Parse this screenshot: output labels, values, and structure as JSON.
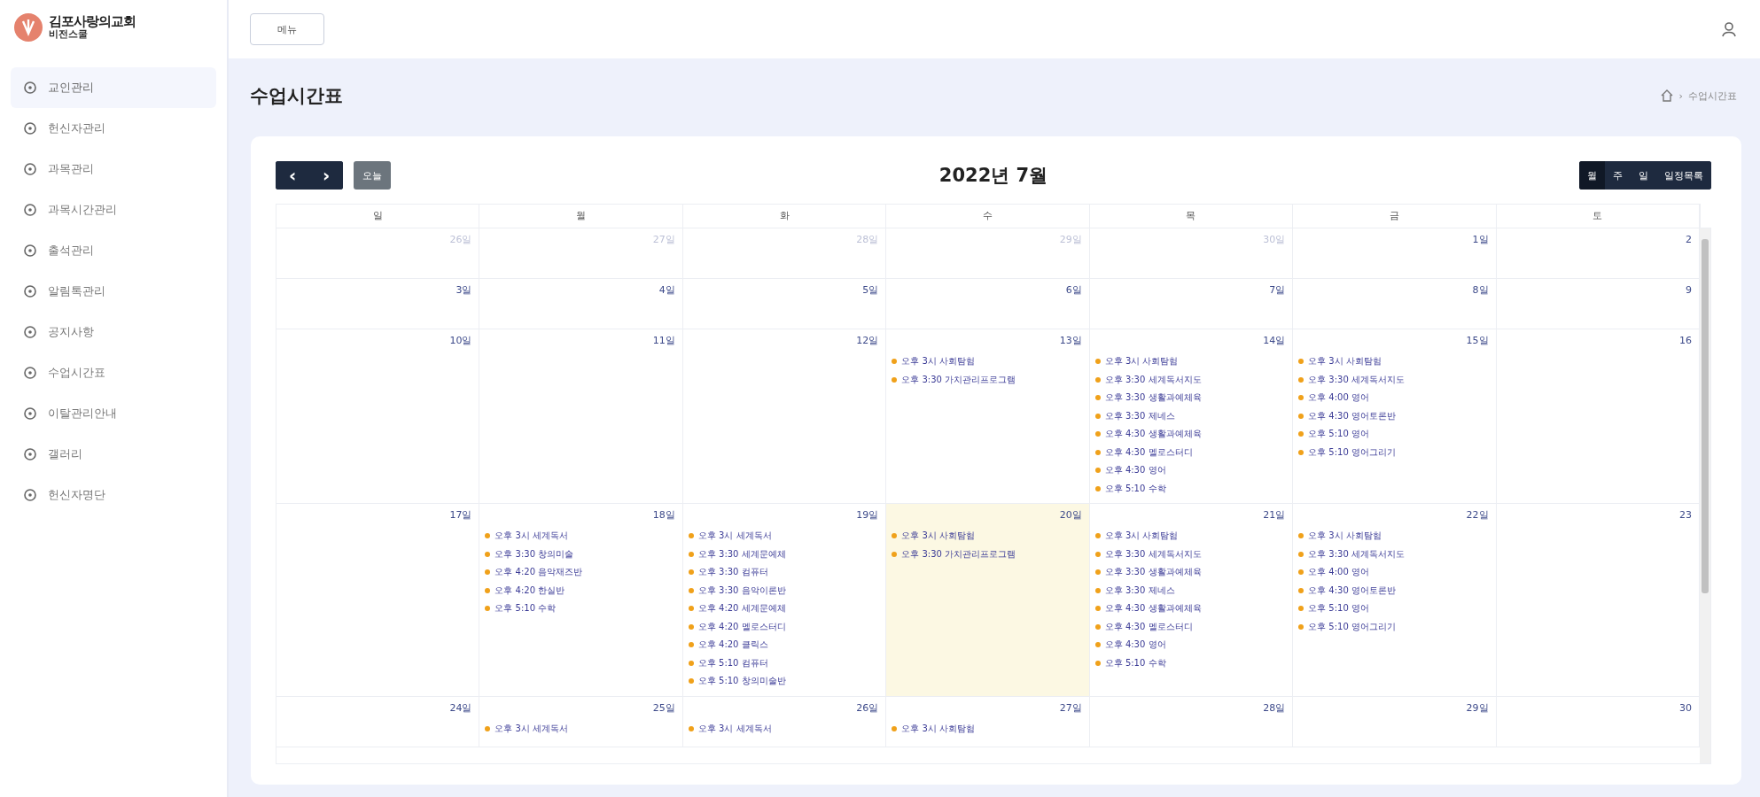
{
  "brand": {
    "name": "김포사랑의교회",
    "subtitle": "비전스쿨"
  },
  "sidebar": {
    "items": [
      {
        "label": "교인관리",
        "selected": true
      },
      {
        "label": "헌신자관리",
        "selected": false
      },
      {
        "label": "과목관리",
        "selected": false
      },
      {
        "label": "과목시간관리",
        "selected": false
      },
      {
        "label": "출석관리",
        "selected": false
      },
      {
        "label": "알림톡관리",
        "selected": false
      },
      {
        "label": "공지사항",
        "selected": false
      },
      {
        "label": "수업시간표",
        "selected": false
      },
      {
        "label": "이탈관리안내",
        "selected": false
      },
      {
        "label": "갤러리",
        "selected": false
      },
      {
        "label": "헌신자명단",
        "selected": false
      }
    ]
  },
  "topbar": {
    "menu_button": "메뉴"
  },
  "page": {
    "title": "수업시간표",
    "breadcrumb": [
      {
        "label": "›"
      },
      {
        "label": "수업시간표"
      }
    ]
  },
  "calendar": {
    "title": "2022년 7월",
    "prev": "‹",
    "next": "›",
    "today_button": "오늘",
    "views": [
      {
        "label": "월",
        "selected": true
      },
      {
        "label": "주",
        "selected": false
      },
      {
        "label": "일",
        "selected": false
      },
      {
        "label": "일정목록",
        "selected": false
      }
    ],
    "weekdays": [
      "일",
      "월",
      "화",
      "수",
      "목",
      "금",
      "토"
    ],
    "weeks": [
      {
        "days": [
          {
            "label": "26일",
            "other_month": true,
            "today": false
          },
          {
            "label": "27일",
            "other_month": true,
            "today": false
          },
          {
            "label": "28일",
            "other_month": true,
            "today": false
          },
          {
            "label": "29일",
            "other_month": true,
            "today": false
          },
          {
            "label": "30일",
            "other_month": true,
            "today": false
          },
          {
            "label": "1일",
            "other_month": false,
            "today": false
          },
          {
            "label": "2",
            "other_month": false,
            "today": false
          }
        ]
      },
      {
        "days": [
          {
            "label": "3일",
            "other_month": false,
            "today": false
          },
          {
            "label": "4일",
            "other_month": false,
            "today": false
          },
          {
            "label": "5일",
            "other_month": false,
            "today": false
          },
          {
            "label": "6일",
            "other_month": false,
            "today": false
          },
          {
            "label": "7일",
            "other_month": false,
            "today": false
          },
          {
            "label": "8일",
            "other_month": false,
            "today": false
          },
          {
            "label": "9",
            "other_month": false,
            "today": false
          }
        ]
      },
      {
        "days": [
          {
            "label": "10일",
            "other_month": false,
            "today": false
          },
          {
            "label": "11일",
            "other_month": false,
            "today": false
          },
          {
            "label": "12일",
            "other_month": false,
            "today": false
          },
          {
            "label": "13일",
            "other_month": false,
            "today": false,
            "events": [
              "오후 3시 사회탐험",
              "오후 3:30 가치관리프로그램"
            ]
          },
          {
            "label": "14일",
            "other_month": false,
            "today": false,
            "events": [
              "오후 3시 사회탐험",
              "오후 3:30 세계독서지도",
              "오후 3:30 생활과예체육",
              "오후 3:30 제네스",
              "오후 4:30 생활과예체육",
              "오후 4:30 멜로스터디",
              "오후 4:30 영어",
              "오후 5:10 수학"
            ]
          },
          {
            "label": "15일",
            "other_month": false,
            "today": false,
            "events": [
              "오후 3시 사회탐험",
              "오후 3:30 세계독서지도",
              "오후 4:00 영어",
              "오후 4:30 영어토론반",
              "오후 5:10 영어",
              "오후 5:10 영어그리기"
            ]
          },
          {
            "label": "16",
            "other_month": false,
            "today": false
          }
        ]
      },
      {
        "days": [
          {
            "label": "17일",
            "other_month": false,
            "today": false
          },
          {
            "label": "18일",
            "other_month": false,
            "today": false,
            "events": [
              "오후 3시 세계독서",
              "오후 3:30 창의미술",
              "오후 4:20 음악재즈반",
              "오후 4:20 한실반",
              "오후 5:10 수학"
            ]
          },
          {
            "label": "19일",
            "other_month": false,
            "today": false,
            "events": [
              "오후 3시 세계독서",
              "오후 3:30 세계문예체",
              "오후 3:30 컴퓨터",
              "오후 3:30 음악이론반",
              "오후 4:20 세계문예체",
              "오후 4:20 멜로스터디",
              "오후 4:20 클릭스",
              "오후 5:10 컴퓨터",
              "오후 5:10 창의미술반"
            ]
          },
          {
            "label": "20일",
            "other_month": false,
            "today": true,
            "events": [
              "오후 3시 사회탐험",
              "오후 3:30 가치관리프로그램"
            ]
          },
          {
            "label": "21일",
            "other_month": false,
            "today": false,
            "events": [
              "오후 3시 사회탐험",
              "오후 3:30 세계독서지도",
              "오후 3:30 생활과예체육",
              "오후 3:30 제네스",
              "오후 4:30 생활과예체육",
              "오후 4:30 멜로스터디",
              "오후 4:30 영어",
              "오후 5:10 수학"
            ]
          },
          {
            "label": "22일",
            "other_month": false,
            "today": false,
            "events": [
              "오후 3시 사회탐험",
              "오후 3:30 세계독서지도",
              "오후 4:00 영어",
              "오후 4:30 영어토론반",
              "오후 5:10 영어",
              "오후 5:10 영어그리기"
            ]
          },
          {
            "label": "23",
            "other_month": false,
            "today": false
          }
        ]
      },
      {
        "days": [
          {
            "label": "24일",
            "other_month": false,
            "today": false
          },
          {
            "label": "25일",
            "other_month": false,
            "today": false,
            "events": [
              "오후 3시 세계독서"
            ]
          },
          {
            "label": "26일",
            "other_month": false,
            "today": false,
            "events": [
              "오후 3시 세계독서"
            ]
          },
          {
            "label": "27일",
            "other_month": false,
            "today": false,
            "events": [
              "오후 3시 사회탐험"
            ]
          },
          {
            "label": "28일",
            "other_month": false,
            "today": false
          },
          {
            "label": "29일",
            "other_month": false,
            "today": false
          },
          {
            "label": "30",
            "other_month": false,
            "today": false
          }
        ]
      }
    ]
  }
}
